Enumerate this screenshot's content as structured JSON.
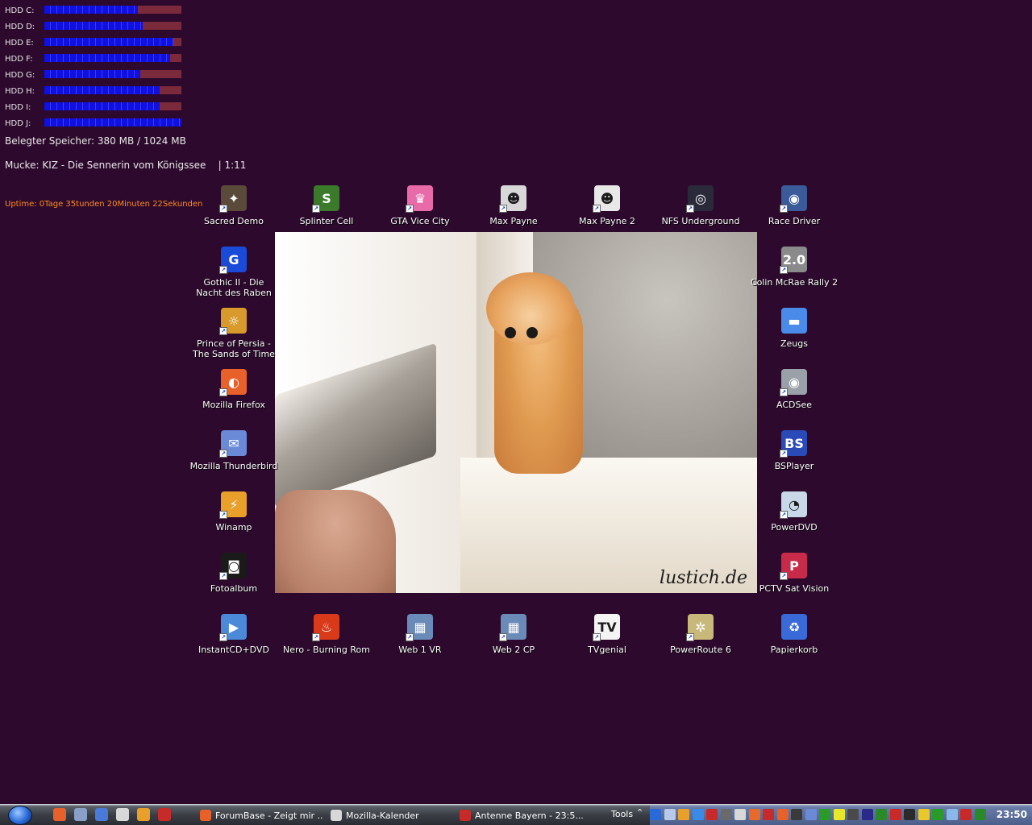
{
  "hdd_monitor": {
    "drives": [
      {
        "label": "HDD C:",
        "used_fraction": 0.68
      },
      {
        "label": "HDD D:",
        "used_fraction": 0.72
      },
      {
        "label": "HDD E:",
        "used_fraction": 0.94
      },
      {
        "label": "HDD F:",
        "used_fraction": 0.92
      },
      {
        "label": "HDD G:",
        "used_fraction": 0.7
      },
      {
        "label": "HDD H:",
        "used_fraction": 0.84
      },
      {
        "label": "HDD I:",
        "used_fraction": 0.84
      },
      {
        "label": "HDD J:",
        "used_fraction": 1.0
      }
    ],
    "memory_text": "Belegter Speicher: 380 MB  / 1024 MB",
    "music_text": "Mucke: KIZ - Die Sennerin vom Königssee    | 1:11",
    "uptime_text": "Uptime: 0Tage 35tunden 20Minuten 22Sekunden",
    "colors": {
      "used": "#1010e0",
      "free": "#7a2a3a",
      "uptime": "#ff8a1a"
    }
  },
  "wallpaper": {
    "watermark": "lustich.de"
  },
  "desktop_icons": [
    {
      "label": "Sacred Demo",
      "icon": "sacred-icon",
      "color": "#5a4a3a",
      "glyph": "✦"
    },
    {
      "label": "Splinter Cell",
      "icon": "splinter-cell-icon",
      "color": "#3a7a2a",
      "glyph": "S"
    },
    {
      "label": "GTA Vice City",
      "icon": "gta-vice-city-icon",
      "color": "#e86aa8",
      "glyph": "♛"
    },
    {
      "label": "Max Payne",
      "icon": "max-payne-icon",
      "color": "#d8d8d8",
      "glyph": "☻"
    },
    {
      "label": "Max Payne 2",
      "icon": "max-payne-2-icon",
      "color": "#e8e8e8",
      "glyph": "☻"
    },
    {
      "label": "NFS Underground",
      "icon": "nfs-underground-icon",
      "color": "#2a2a3a",
      "glyph": "◎"
    },
    {
      "label": "Race Driver",
      "icon": "race-driver-icon",
      "color": "#3a5a9a",
      "glyph": "◉"
    },
    {
      "label": "Gothic II - Die Nacht des Raben",
      "icon": "gothic-icon",
      "color": "#1a4ad8",
      "glyph": "G"
    },
    {
      "label": "Colin McRae Rally 2",
      "icon": "colin-mcrae-icon",
      "color": "#8a8a8a",
      "glyph": "2.0"
    },
    {
      "label": "Prince of Persia - The Sands of Time",
      "icon": "prince-of-persia-icon",
      "color": "#d89a2a",
      "glyph": "☼"
    },
    {
      "label": "Zeugs",
      "icon": "folder-icon",
      "color": "#4a8ae8",
      "glyph": "▬"
    },
    {
      "label": "Mozilla Firefox",
      "icon": "firefox-icon",
      "color": "#e8602a",
      "glyph": "◐"
    },
    {
      "label": "ACDSee",
      "icon": "acdsee-icon",
      "color": "#9aa0a8",
      "glyph": "◉"
    },
    {
      "label": "Mozilla Thunderbird",
      "icon": "thunderbird-icon",
      "color": "#6a8ad8",
      "glyph": "✉"
    },
    {
      "label": "BSPlayer",
      "icon": "bsplayer-icon",
      "color": "#2a4ab8",
      "glyph": "BS"
    },
    {
      "label": "Winamp",
      "icon": "winamp-icon",
      "color": "#e8a02a",
      "glyph": "⚡"
    },
    {
      "label": "PowerDVD",
      "icon": "powerdvd-icon",
      "color": "#c8d8e8",
      "glyph": "◔"
    },
    {
      "label": "Fotoalbum",
      "icon": "fotoalbum-icon",
      "color": "#1a1a1a",
      "glyph": "◙"
    },
    {
      "label": "PCTV Sat Vision",
      "icon": "pctv-icon",
      "color": "#c82a4a",
      "glyph": "P"
    },
    {
      "label": "InstantCD+DVD",
      "icon": "instantcd-icon",
      "color": "#4a8ad8",
      "glyph": "▶"
    },
    {
      "label": "Nero - Burning Rom",
      "icon": "nero-icon",
      "color": "#d83a1a",
      "glyph": "♨"
    },
    {
      "label": "Web 1 VR",
      "icon": "web1-vr-icon",
      "color": "#6a8ab8",
      "glyph": "▦"
    },
    {
      "label": "Web 2 CP",
      "icon": "web2-cp-icon",
      "color": "#6a8ab8",
      "glyph": "▦"
    },
    {
      "label": "TVgenial",
      "icon": "tvgenial-icon",
      "color": "#f4f4f4",
      "glyph": "TV"
    },
    {
      "label": "PowerRoute 6",
      "icon": "powerroute-icon",
      "color": "#c8b87a",
      "glyph": "✲"
    },
    {
      "label": "Papierkorb",
      "icon": "recycle-bin-icon",
      "color": "#3a6ad8",
      "glyph": "♻"
    }
  ],
  "taskbar": {
    "quick_launch": [
      {
        "icon": "firefox-icon",
        "color": "#e8602a"
      },
      {
        "icon": "thunderbird-icon",
        "color": "#8aa0c8"
      },
      {
        "icon": "show-desktop-icon",
        "color": "#4a7ad8"
      },
      {
        "icon": "printer-icon",
        "color": "#d8d8d8"
      },
      {
        "icon": "winamp-icon",
        "color": "#e8a02a"
      },
      {
        "icon": "media-icon",
        "color": "#c82a2a"
      }
    ],
    "tasks": [
      {
        "label": "ForumBase - Zeigt mir ...",
        "icon": "firefox-icon",
        "color": "#e8602a"
      },
      {
        "label": "Mozilla-Kalender",
        "icon": "calendar-icon",
        "color": "#d8d8d8"
      },
      {
        "label": "Antenne Bayern - 23:5...",
        "icon": "radio-icon",
        "color": "#c82a2a"
      }
    ],
    "tools_label": "Tools",
    "clock": "23:50",
    "tray_colors": [
      "#2a6ad8",
      "#b8c8e8",
      "#e8a02a",
      "#3a8ae8",
      "#c82a2a",
      "#6a6a6a",
      "#d8d8d8",
      "#e86a2a",
      "#c82a2a",
      "#e8602a",
      "#3a3a3a",
      "#6a8ad8",
      "#2a9a2a",
      "#e8e82a",
      "#4a4a4a",
      "#2a2a8a",
      "#2a8a2a",
      "#c82a2a",
      "#2a2a2a",
      "#e8c82a",
      "#2a9a2a",
      "#8ab8e8",
      "#c82a2a",
      "#2a8a2a"
    ]
  }
}
